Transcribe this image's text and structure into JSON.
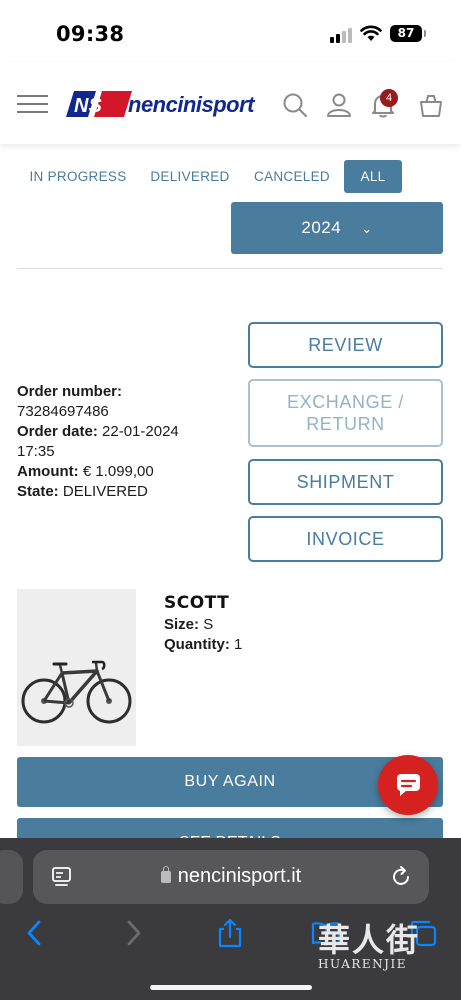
{
  "status_bar": {
    "time": "09:38",
    "battery": "87"
  },
  "header": {
    "logo_text": "nencinisport",
    "logo_mark": "NS",
    "cart_badge": "4",
    "icons": [
      "menu-icon",
      "search-icon",
      "account-icon",
      "bell-icon",
      "bag-icon"
    ]
  },
  "filters": {
    "tabs": [
      "IN PROGRESS",
      "DELIVERED",
      "CANCELED",
      "ALL"
    ],
    "active_tab": "ALL",
    "year": "2024"
  },
  "order": {
    "number_label": "Order number:",
    "number": "73284697486",
    "date_label": "Order date:",
    "date": "22-01-2024",
    "time": "17:35",
    "amount_label": "Amount:",
    "amount": "€ 1.099,00",
    "state_label": "State:",
    "state": "DELIVERED"
  },
  "actions": {
    "review": "REVIEW",
    "exchange_line1": "EXCHANGE /",
    "exchange_line2": "RETURN",
    "shipment": "SHIPMENT",
    "invoice": "INVOICE"
  },
  "product": {
    "name": "SCOTT",
    "size_label": "Size:",
    "size": "S",
    "quantity_label": "Quantity:",
    "quantity": "1"
  },
  "buttons": {
    "buy_again": "BUY AGAIN",
    "second": "SEE DETAILS"
  },
  "browser": {
    "url": "nencinisport.it"
  },
  "watermark": {
    "cn": "華人街",
    "en": "HUARENJIE"
  },
  "colors": {
    "primary": "#4a7c9e",
    "logo_blue": "#10288f",
    "logo_red": "#d4162a",
    "badge": "#9a1b1b",
    "chat": "#d62121",
    "safari_bar": "#3b3b3d",
    "safari_blue": "#0a84ff"
  }
}
